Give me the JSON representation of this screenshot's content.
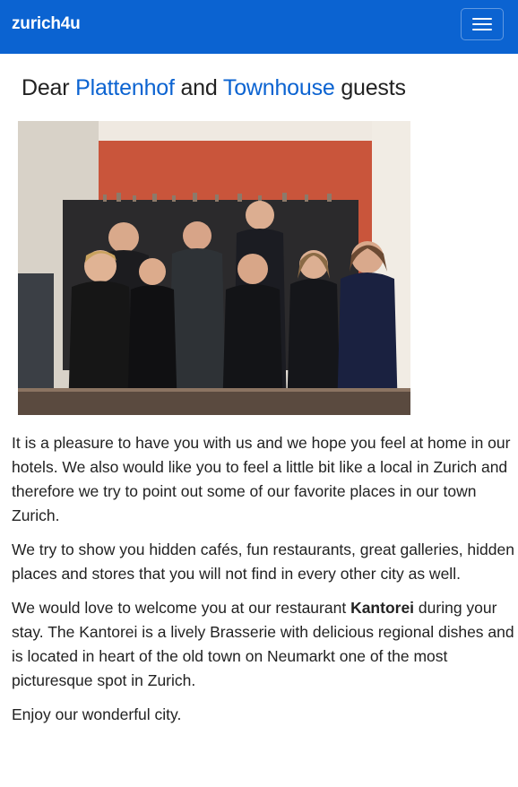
{
  "navbar": {
    "brand": "zurich4u",
    "menu_icon": "hamburger-menu-icon",
    "color": "#0b63d1"
  },
  "heading": {
    "prefix": "Dear ",
    "link1": "Plattenhof",
    "middle": " and ",
    "link2": "Townhouse",
    "suffix": " guests"
  },
  "photo": {
    "subject": "team-photo"
  },
  "paragraphs": {
    "p1": "It is a pleasure to have you with us and we hope you feel at home in our hotels. We also would like you to feel a little bit like a local in Zurich and therefore we try to point out some of our favorite places in our town Zurich.",
    "p2": "We try to show you hidden cafés, fun restaurants, great galleries, hidden places and stores that you will not find in every other city as well.",
    "p3_start": "We would love to welcome you at our restaurant ",
    "p3_bold": "Kantorei",
    "p3_end": " during your stay. The Kantorei is a lively Brasserie with delicious regional dishes and is located in heart of the old town on Neumarkt one of the most picturesque spot in Zurich.",
    "p4": "Enjoy our wonderful city."
  },
  "colors": {
    "link": "#0b63d1",
    "navbar": "#0b63d1",
    "text": "#222222"
  }
}
